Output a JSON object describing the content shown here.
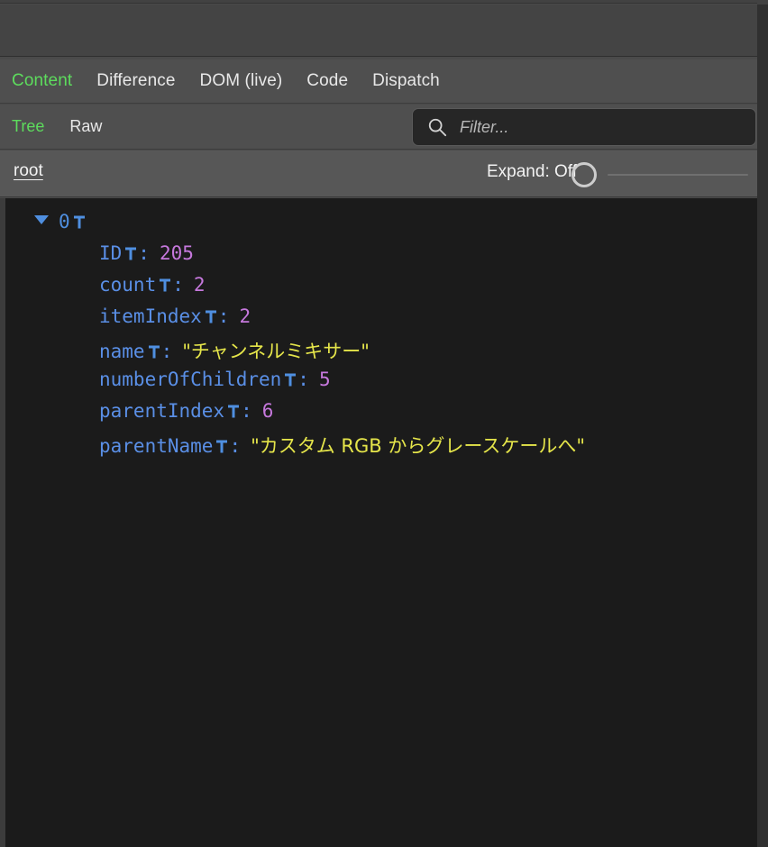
{
  "window": {
    "background_color": "#4a4a4a",
    "content_background_color": "#1b1b1b",
    "accent_color": "#5ddc5d"
  },
  "tabs": {
    "items": [
      {
        "label": "Content",
        "active": true
      },
      {
        "label": "Difference",
        "active": false
      },
      {
        "label": "DOM (live)",
        "active": false
      },
      {
        "label": "Code",
        "active": false
      },
      {
        "label": "Dispatch",
        "active": false
      }
    ]
  },
  "subtabs": {
    "items": [
      {
        "label": "Tree",
        "active": true
      },
      {
        "label": "Raw",
        "active": false
      }
    ]
  },
  "filter": {
    "value": "",
    "placeholder": "Filter...",
    "icon": "search-icon"
  },
  "breadcrumb": {
    "root_label": "root"
  },
  "expand": {
    "label": "Expand: Off",
    "state": "Off",
    "slider_position": 0
  },
  "tree": {
    "nodes": [
      {
        "index": "0",
        "expanded": true,
        "twisty": "chevron-down-icon",
        "pin": "pin-icon",
        "properties": [
          {
            "key": "ID",
            "pin": "pin-icon",
            "colon": ":",
            "value": "205",
            "type": "number"
          },
          {
            "key": "count",
            "pin": "pin-icon",
            "colon": ":",
            "value": "2",
            "type": "number"
          },
          {
            "key": "itemIndex",
            "pin": "pin-icon",
            "colon": ":",
            "value": "2",
            "type": "number"
          },
          {
            "key": "name",
            "pin": "pin-icon",
            "colon": ":",
            "value": "\"チャンネルミキサー\"",
            "type": "string"
          },
          {
            "key": "numberOfChildren",
            "pin": "pin-icon",
            "colon": ":",
            "value": "5",
            "type": "number"
          },
          {
            "key": "parentIndex",
            "pin": "pin-icon",
            "colon": ":",
            "value": "6",
            "type": "number"
          },
          {
            "key": "parentName",
            "pin": "pin-icon",
            "colon": ":",
            "value": "\"カスタム RGB からグレースケールへ\"",
            "type": "string"
          }
        ]
      }
    ]
  }
}
